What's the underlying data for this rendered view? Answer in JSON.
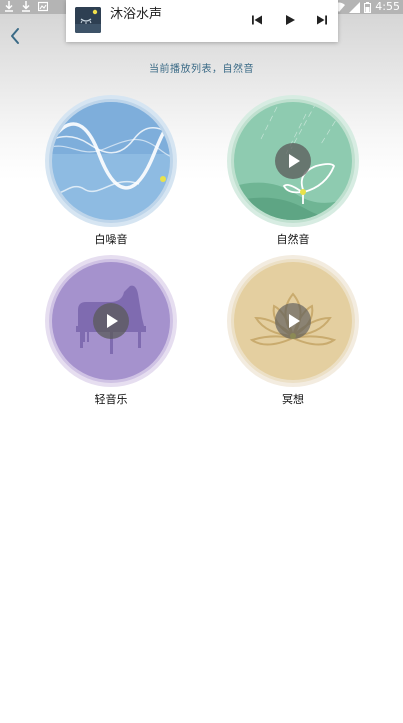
{
  "status_bar": {
    "time": "4:55",
    "icons": [
      "download-icon",
      "download-icon",
      "image-icon",
      "wifi-icon",
      "signal-icon",
      "battery-icon"
    ]
  },
  "player": {
    "track_title": "沐浴水声",
    "controls": [
      "skip-previous-icon",
      "play-icon",
      "skip-next-icon"
    ]
  },
  "header": {
    "subtitle": "当前播放列表，自然音"
  },
  "categories": [
    {
      "label": "白噪音",
      "color": "#8fb6de",
      "playing": true
    },
    {
      "label": "自然音",
      "color": "#8ecbb0",
      "playing": false
    },
    {
      "label": "轻音乐",
      "color": "#a592cd",
      "playing": false
    },
    {
      "label": "冥想",
      "color": "#e4cfa0",
      "playing": false
    }
  ],
  "colors": {
    "accent": "#3a6a86",
    "indicator": "#e9e24a"
  }
}
